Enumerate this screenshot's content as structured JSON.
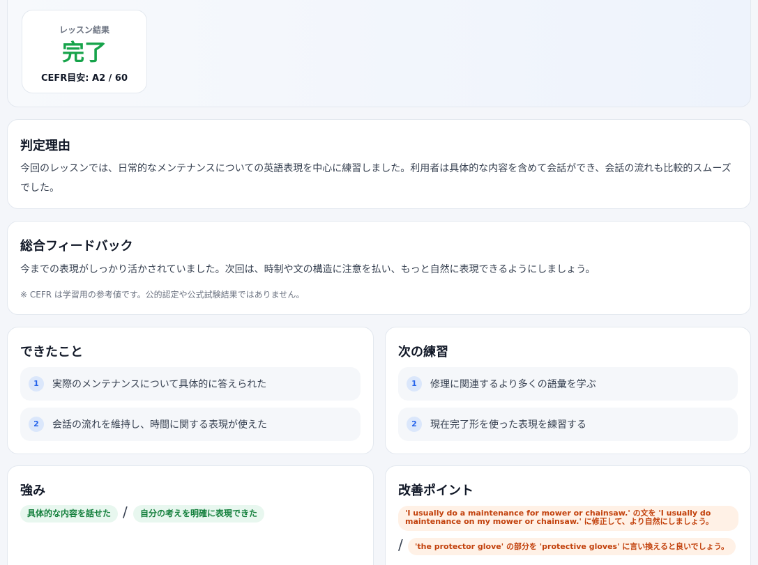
{
  "result": {
    "label": "レッスン結果",
    "value": "完了",
    "cefr": "CEFR目安: A2 / 60",
    "value_color": "#16a34a"
  },
  "reason": {
    "title": "判定理由",
    "text": "今回のレッスンでは、日常的なメンテナンスについての英語表現を中心に練習しました。利用者は具体的な内容を含めて会話ができ、会話の流れも比較的スムーズでした。"
  },
  "feedback": {
    "title": "総合フィードバック",
    "text": "今までの表現がしっかり活かされていました。次回は、時制や文の構造に注意を払い、もっと自然に表現できるようにしましょう。",
    "note": "※ CEFR は学習用の参考値です。公的認定や公式試験結果ではありません。"
  },
  "achievements": {
    "title": "できたこと",
    "items": [
      {
        "num": "1",
        "text": "実際のメンテナンスについて具体的に答えられた"
      },
      {
        "num": "2",
        "text": "会話の流れを維持し、時間に関する表現が使えた"
      }
    ]
  },
  "next_practice": {
    "title": "次の練習",
    "items": [
      {
        "num": "1",
        "text": "修理に関連するより多くの語彙を学ぶ"
      },
      {
        "num": "2",
        "text": "現在完了形を使った表現を練習する"
      }
    ]
  },
  "strengths": {
    "title": "強み",
    "separator": "/",
    "tags": [
      "具体的な内容を話せた",
      "自分の考えを明確に表現できた"
    ]
  },
  "improvements": {
    "title": "改善ポイント",
    "separator": "/",
    "tags": [
      "'I usually do a maintenance for mower or chainsaw.' の文を 'I usually do maintenance on my mower or chainsaw.' に修正して、より自然にしましょう。",
      "'the protector glove' の部分を 'protective gloves' に言い換えると良いでしょう。"
    ]
  }
}
